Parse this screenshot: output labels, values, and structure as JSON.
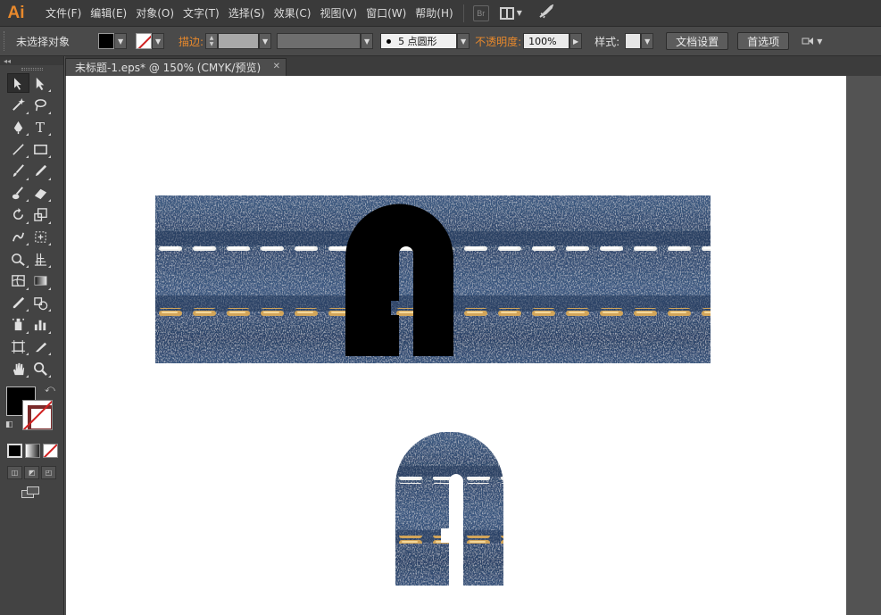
{
  "app": {
    "logo": "Ai",
    "menu": [
      "文件(F)",
      "编辑(E)",
      "对象(O)",
      "文字(T)",
      "选择(S)",
      "效果(C)",
      "视图(V)",
      "窗口(W)",
      "帮助(H)"
    ],
    "bridge_label": "Br"
  },
  "control_bar": {
    "selection_status": "未选择对象",
    "stroke_label": "描边:",
    "brush_value": "5 点圆形",
    "opacity_label": "不透明度:",
    "opacity_value": "100%",
    "style_label": "样式:",
    "doc_setup_button": "文档设置",
    "preferences_button": "首选项"
  },
  "document": {
    "tab_title": "未标题-1.eps* @ 150% (CMYK/预览)",
    "close_glyph": "✕"
  },
  "colors": {
    "accent_orange": "#e8892c",
    "denim_base": "#2f4a6e",
    "stitch_white": "#f1f1ee",
    "stitch_gold": "#d2a55a",
    "stroke_none_red": "#d02020"
  },
  "tools": [
    [
      "selection-tool",
      "direct-selection-tool"
    ],
    [
      "magic-wand-tool",
      "lasso-tool"
    ],
    [
      "pen-tool",
      "type-tool"
    ],
    [
      "line-segment-tool",
      "rectangle-tool"
    ],
    [
      "paintbrush-tool",
      "pencil-tool"
    ],
    [
      "blob-brush-tool",
      "eraser-tool"
    ],
    [
      "rotate-tool",
      "scale-tool"
    ],
    [
      "warp-tool",
      "free-transform-tool"
    ],
    [
      "shape-builder-tool",
      "perspective-grid-tool"
    ],
    [
      "mesh-tool",
      "gradient-tool"
    ],
    [
      "eyedropper-tool",
      "blend-tool"
    ],
    [
      "symbol-sprayer-tool",
      "column-graph-tool"
    ],
    [
      "artboard-tool",
      "slice-tool"
    ],
    [
      "hand-tool",
      "zoom-tool"
    ]
  ]
}
